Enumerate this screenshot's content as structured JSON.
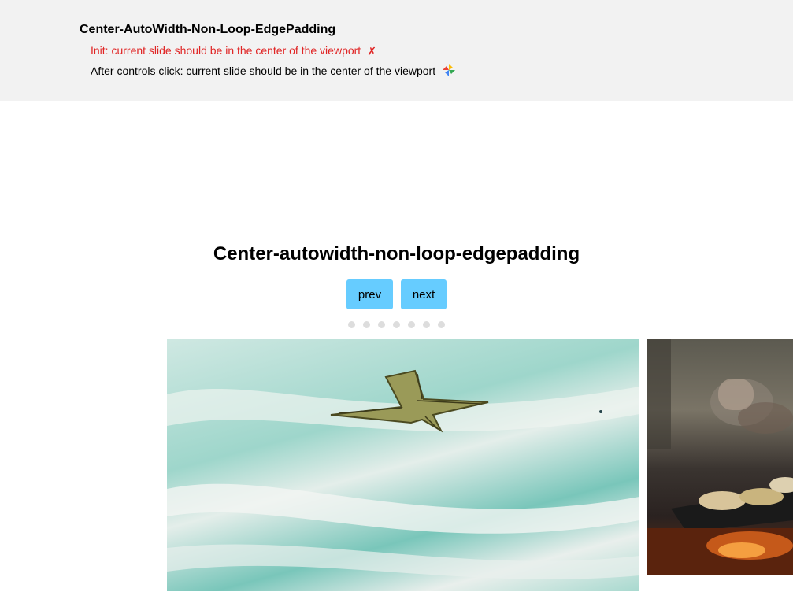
{
  "test": {
    "title": "Center-AutoWidth-Non-Loop-EdgePadding",
    "init_line": "Init: current slide should be in the center of the viewport",
    "init_mark": "✗",
    "after_line": "After controls click: current slide should be in the center of the viewport",
    "after_icon": "pinwheel-icon"
  },
  "demo": {
    "title": "Center-autowidth-non-loop-edgepadding",
    "prev_label": "prev",
    "next_label": "next",
    "dot_count": 7,
    "active_dot": 0
  },
  "colors": {
    "panel_bg": "#f2f2f2",
    "fail": "#e02424",
    "button_bg": "#66ccff",
    "dot": "#dddddd"
  }
}
